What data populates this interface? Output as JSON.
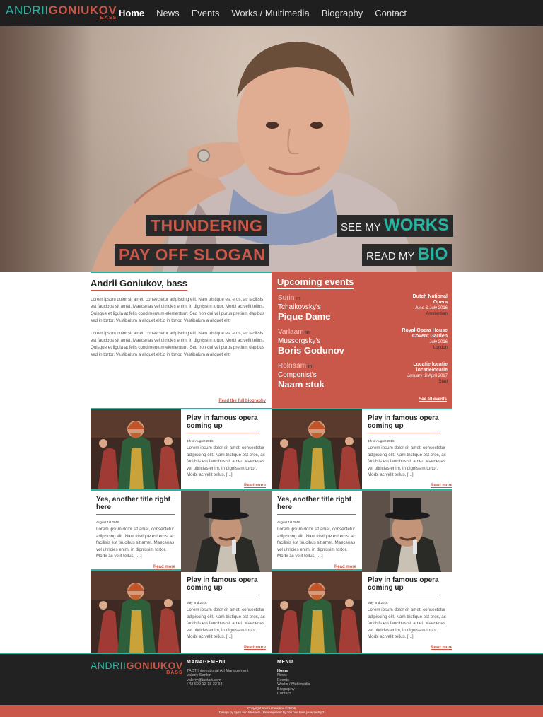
{
  "header": {
    "logo_first": "ANDRII",
    "logo_last": "GONIUKOV",
    "logo_sub": "BASS",
    "nav": [
      {
        "label": "Home",
        "active": true
      },
      {
        "label": "News"
      },
      {
        "label": "Events"
      },
      {
        "label": "Works / Multimedia"
      },
      {
        "label": "Biography"
      },
      {
        "label": "Contact"
      }
    ]
  },
  "hero": {
    "slogan_line1": "THUNDERING",
    "slogan_line2": "PAY OFF SLOGAN",
    "cta_works_small": "SEE MY",
    "cta_works_big": "WORKS",
    "cta_bio_small": "READ MY",
    "cta_bio_big": "BIO"
  },
  "bio": {
    "title": "Andrii Goniukov, bass",
    "para1": "Lorem ipsum dolor sit amet, consectetur adipiscing elit. Nam tristique est eros, ac facilisis est faucibus sit amet. Maecenas vel ultricies enim, in dignissim tortor. Morbi ac velit tellus. Quisque et ligula at felis condimentum elementum. Sed non dui vel purus pretium dapibus sed in tortor. Vestibulum a aliquet elit.d in tortor. Vestibulum a aliquet elit.",
    "para2": "Lorem ipsum dolor sit amet, consectetur adipiscing elit. Nam tristique est eros, ac facilisis est faucibus sit amet. Maecenas vel ultricies enim, in dignissim tortor. Morbi ac velit tellus. Quisque et ligula at felis condimentum elementum. Sed non dui vel purus pretium dapibus sed in tortor. Vestibulum a aliquet elit.d in tortor. Vestibulum a aliquet elit.",
    "more": "Read the full biography"
  },
  "events": {
    "title": "Upcoming events",
    "in": "in",
    "items": [
      {
        "role": "Surin",
        "composer": "Tchaikovsky's",
        "opera": "Pique Dame",
        "venue": "Dutch National Opera",
        "date": "June & July 2016",
        "city": "Amsterdam"
      },
      {
        "role": "Varlaam",
        "composer": "Mussorgsky's",
        "opera": "Boris Godunov",
        "venue": "Royal Opera House Covent Garden",
        "date": "July 2016",
        "city": "London"
      },
      {
        "role": "Rolnaam",
        "composer": "Componist's",
        "opera": "Naam stuk",
        "venue": "Locatie locatie locatielocatie",
        "date": "January till April 2017",
        "city": "Stad"
      }
    ],
    "more": "See all events"
  },
  "cards": [
    {
      "title": "Play in famous opera coming up",
      "date": "4th of August 2016",
      "body": "Lorem ipsum dolor sit amet, consectetur adipiscing elit. Nam tristique est eros, ac facilisis est faucibus sit amet. Maecenas vel ultricies enim, in dignissim tortor. Morbi ac velit tellus. [...]",
      "more": "Read more"
    },
    {
      "title": "Play in famous opera coming up",
      "date": "4th of August 2016",
      "body": "Lorem ipsum dolor sit amet, consectetur adipiscing elit. Nam tristique est eros, ac facilisis est faucibus sit amet. Maecenas vel ultricies enim, in dignissim tortor. Morbi ac velit tellus. [...]",
      "more": "Read more"
    },
    {
      "title": "Yes, another title right here",
      "date": "August 1st 2016",
      "body": "Lorem ipsum dolor sit amet, consectetur adipiscing elit. Nam tristique est eros, ac facilisis est faucibus sit amet. Maecenas vel ultricies enim, in dignissim tortor. Morbi ac velit tellus. [...]",
      "more": "Read more"
    },
    {
      "title": "Yes, another title right here",
      "date": "August 1st 2016",
      "body": "Lorem ipsum dolor sit amet, consectetur adipiscing elit. Nam tristique est eros, ac facilisis est faucibus sit amet. Maecenas vel ultricies enim, in dignissim tortor. Morbi ac velit tellus. [...]",
      "more": "Read more"
    },
    {
      "title": "Play in famous opera coming up",
      "date": "May 2nd 2016",
      "body": "Lorem ipsum dolor sit amet, consectetur adipiscing elit. Nam tristique est eros, ac facilisis est faucibus sit amet. Maecenas vel ultricies enim, in dignissim tortor. Morbi ac velit tellus. [...]",
      "more": "Read more"
    },
    {
      "title": "Play in famous opera coming up",
      "date": "May 2nd 2016",
      "body": "Lorem ipsum dolor sit amet, consectetur adipiscing elit. Nam tristique est eros, ac facilisis est faucibus sit amet. Maecenas vel ultricies enim, in dignissim tortor. Morbi ac velit tellus. [...]",
      "more": "Read more"
    }
  ],
  "footer": {
    "management_title": "MANAGEMENT",
    "management_lines": [
      "TACT International Art Management",
      "Valeriy Senkin",
      "valeriy@tactart.com",
      "+43 699 12 18 22 64"
    ],
    "menu_title": "MENU",
    "menu_items": [
      "Home",
      "News",
      "Events",
      "Works / Multimedia",
      "Biography",
      "Contact"
    ],
    "copyright": "Copyright Andrii Goniukov © 2016",
    "credits": "Design by Sjors van Wessem | Development by Too hoe heet jouw bedrijf?"
  },
  "colors": {
    "accent": "#c9584a",
    "teal": "#26b5a0",
    "dark": "#1f1f1f"
  }
}
